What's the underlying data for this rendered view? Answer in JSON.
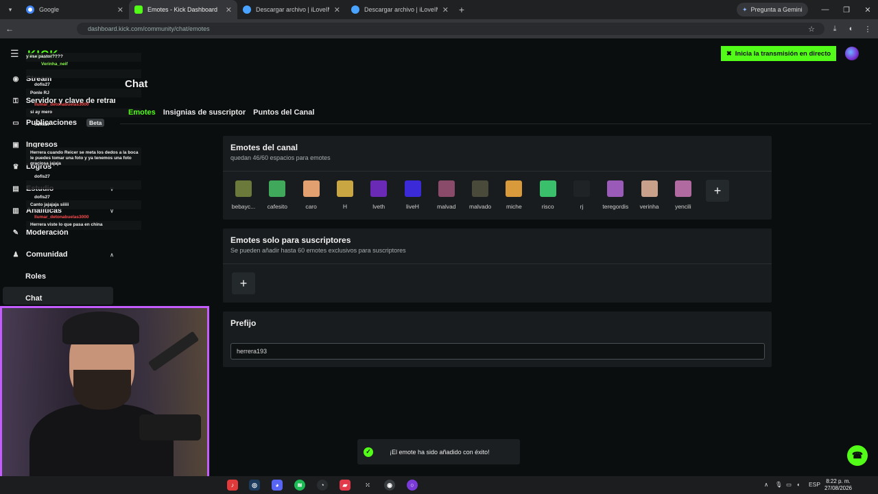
{
  "browser": {
    "tabs": [
      {
        "title": "Google",
        "favicon_color": "#4285f4"
      },
      {
        "title": "Emotes - Kick Dashboard",
        "favicon_color": "#53fc18"
      },
      {
        "title": "Descargar archivo | iLoveIMG",
        "favicon_color": "#4aa3ff"
      },
      {
        "title": "Descargar archivo | iLoveIMG",
        "favicon_color": "#4aa3ff"
      }
    ],
    "gemini_label": "Pregunta a Gemini",
    "url": "dashboard.kick.com/community/chat/emotes"
  },
  "header": {
    "logo": "KICK",
    "cta_label": "Inicia la transmisión en directo"
  },
  "sidebar": {
    "items": [
      {
        "label": "Stream",
        "icon": "stream-icon"
      },
      {
        "label": "Servidor y clave de retransmisión",
        "icon": "key-icon"
      },
      {
        "label": "Publicaciones",
        "icon": "post-icon",
        "badge": "Beta"
      },
      {
        "label": "Ingresos",
        "icon": "wallet-icon"
      },
      {
        "label": "Logros",
        "icon": "trophy-icon"
      },
      {
        "label": "Estudio",
        "icon": "studio-icon"
      },
      {
        "label": "Analíticas",
        "icon": "chart-icon"
      },
      {
        "label": "Moderación",
        "icon": "wrench-icon"
      },
      {
        "label": "Comunidad",
        "icon": "people-icon"
      }
    ],
    "subitems": [
      {
        "label": "Roles"
      },
      {
        "label": "Chat"
      }
    ]
  },
  "main": {
    "title": "Chat",
    "tabs": [
      "Emotes",
      "Insignias de suscriptor",
      "Puntos del Canal"
    ],
    "channel_emotes": {
      "title": "Emotes del canal",
      "subtitle": "quedan 46/60 espacios para emotes",
      "emotes": [
        {
          "name": "bebayc...",
          "color": "#6b7a3a"
        },
        {
          "name": "cafesito",
          "color": "#3fa85a"
        },
        {
          "name": "caro",
          "color": "#e2a070"
        },
        {
          "name": "H",
          "color": "#c9a642"
        },
        {
          "name": "lveth",
          "color": "#6a2ab5"
        },
        {
          "name": "liveH",
          "color": "#3a2ad8"
        },
        {
          "name": "malvad",
          "color": "#8a4a6a"
        },
        {
          "name": "malvado",
          "color": "#4a4a3a"
        },
        {
          "name": "miche",
          "color": "#d89a3a"
        },
        {
          "name": "risco",
          "color": "#3ac06a"
        },
        {
          "name": "rj",
          "color": "#1f2325"
        },
        {
          "name": "teregordis",
          "color": "#9a5ab8"
        },
        {
          "name": "verinha",
          "color": "#c9a08a"
        },
        {
          "name": "yencili",
          "color": "#b06aa0"
        }
      ]
    },
    "sub_emotes": {
      "title": "Emotes solo para suscriptores",
      "subtitle": "Se pueden añadir hasta 60 emotes exclusivos para suscriptores"
    },
    "prefix": {
      "title": "Prefijo",
      "value": "herrera193"
    }
  },
  "toast": {
    "message": "¡El emote ha sido añadido con éxito!"
  },
  "chat_overlay": [
    {
      "user": "y ese pastor????",
      "type": "msg"
    },
    {
      "user": "Verinha_neif",
      "type": "green"
    },
    {
      "user": "dofis27",
      "type": "white"
    },
    {
      "user": "Ponle RJ",
      "type": "msg"
    },
    {
      "user": "llumar_detonabuelas3000",
      "type": "red"
    },
    {
      "user": "si ay mero",
      "type": "msg"
    },
    {
      "user": "dofis27",
      "type": "white"
    },
    {
      "user": "Herrera cuando Reicer se meta los dedos a la boca le puedes tomar una foto y ya tenemos una foto graciosa jajaja",
      "type": "msg"
    },
    {
      "user": "dofis27",
      "type": "white"
    },
    {
      "user": "dofis27",
      "type": "white"
    },
    {
      "user": "Canto jajajaja siiiii",
      "type": "msg"
    },
    {
      "user": "llumar_detonabuelas3000",
      "type": "red"
    },
    {
      "user": "Herrera viste lo que pasa en china",
      "type": "msg"
    }
  ],
  "taskbar": {
    "language": "ESP",
    "time": "8:22 p. m.",
    "date": "27/08/2026"
  }
}
